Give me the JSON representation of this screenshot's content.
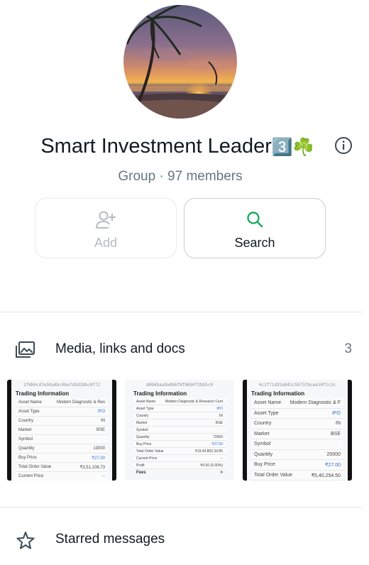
{
  "group": {
    "name": "Smart Investment Leader",
    "name_emoji": "3️⃣☘️",
    "meta": "Group · 97 members"
  },
  "actions": {
    "add_label": "Add",
    "search_label": "Search"
  },
  "media": {
    "label": "Media, links and docs",
    "count": "3"
  },
  "starred": {
    "label": "Starred messages"
  },
  "thumbnails": [
    {
      "url": "1f4b0cd7e50a4bc0be7d2d28bc0f72",
      "title": "Trading Information",
      "rows": [
        {
          "k": "Asset Name",
          "v": "Modern Diagnostic & Res"
        },
        {
          "k": "Asset Type",
          "v": "IPO"
        },
        {
          "k": "Country",
          "v": "IN"
        },
        {
          "k": "Market",
          "v": "BSE"
        },
        {
          "k": "Symbol",
          "v": ""
        },
        {
          "k": "Quantity",
          "v": "13000"
        },
        {
          "k": "Buy Price",
          "v": "₹27.00"
        },
        {
          "k": "Total Order Value",
          "v": "₹3,51,106.73"
        },
        {
          "k": "Current Price",
          "v": "--"
        }
      ]
    },
    {
      "url": "d0b6baa9a4b6f8f9650f2bb5c0",
      "title": "Trading Information",
      "rows": [
        {
          "k": "Asset Name",
          "v": "Modern Diagnostic & Research Cent"
        },
        {
          "k": "Asset Type",
          "v": "IPO"
        },
        {
          "k": "Country",
          "v": "IN"
        },
        {
          "k": "Market",
          "v": "BSE"
        },
        {
          "k": "Symbol",
          "v": ""
        },
        {
          "k": "Quantity",
          "v": "72000"
        },
        {
          "k": "Buy Price",
          "v": "₹27.00"
        },
        {
          "k": "Total Order Value",
          "v": "₹19,44,852.34.85"
        },
        {
          "k": "Current Price",
          "v": "--"
        },
        {
          "k": "Profit",
          "v": "₹0.00 (0.00%)"
        }
      ],
      "footer": {
        "k": "Fees",
        "v": ">"
      }
    },
    {
      "url": "4c1f71d35a941c5b737bcee10f1c3c",
      "title": "Trading Information",
      "rows": [
        {
          "k": "Asset Name",
          "v": "Modern Diagnostic & F"
        },
        {
          "k": "Asset Type",
          "v": "IPO"
        },
        {
          "k": "Country",
          "v": "IN"
        },
        {
          "k": "Market",
          "v": "BSE"
        },
        {
          "k": "Symbol",
          "v": ""
        },
        {
          "k": "Quantity",
          "v": "20000"
        },
        {
          "k": "Buy Price",
          "v": "₹27.00"
        },
        {
          "k": "Total Order Value",
          "v": "₹5,40,254.50"
        }
      ]
    }
  ],
  "colors": {
    "accent": "#1daa61",
    "text_primary": "#111b21",
    "text_secondary": "#667781"
  }
}
